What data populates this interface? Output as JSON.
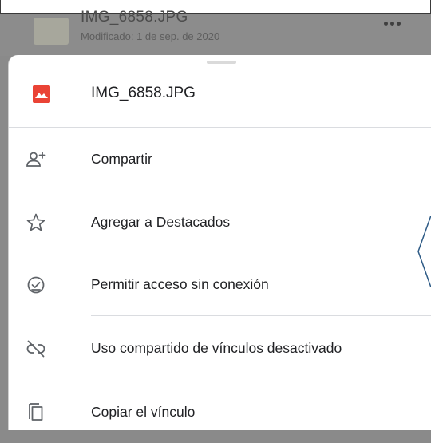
{
  "background_file": {
    "name": "IMG_6858.JPG",
    "modified": "Modificado: 1 de sep. de 2020"
  },
  "sheet": {
    "file_name": "IMG_6858.JPG",
    "items": [
      {
        "label": "Compartir",
        "icon": "person-add-icon"
      },
      {
        "label": "Agregar a Destacados",
        "icon": "star-outline-icon"
      },
      {
        "label": "Permitir acceso sin conexión",
        "icon": "offline-check-icon"
      },
      {
        "label": "Uso compartido de vínculos desactivado",
        "icon": "link-off-icon"
      },
      {
        "label": "Copiar el vínculo",
        "icon": "copy-icon"
      }
    ]
  },
  "colors": {
    "file_icon": "#ea4335",
    "text": "#202124",
    "divider": "#dadce0",
    "scrim": "#8a8a8a"
  }
}
